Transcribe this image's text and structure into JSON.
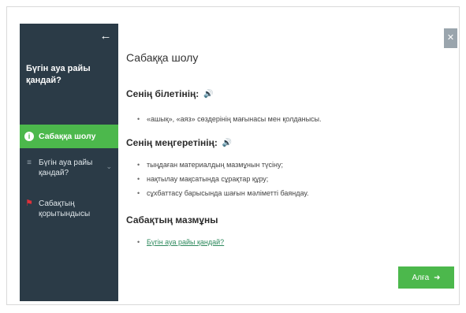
{
  "sidebar": {
    "back_icon": "←",
    "lesson_title": "Бүгін ауа райы қандай?",
    "items": [
      {
        "label": "Сабаққа шолу",
        "icon": "info-icon",
        "active": true
      },
      {
        "label": "Бүгін ауа райы қандай?",
        "icon": "list-icon",
        "active": false
      },
      {
        "label": "Сабақтың қорытындысы",
        "icon": "flag-icon",
        "active": false
      }
    ]
  },
  "close_icon": "✕",
  "main": {
    "title": "Сабаққа шолу",
    "sections": [
      {
        "heading": "Сенің білетінің:",
        "bullets": [
          "«ашық», «аяз» сөздерінің мағынасы мен қолданысы."
        ]
      },
      {
        "heading": "Сенің меңгеретінің:",
        "bullets": [
          "тыңдаған материалдың мазмұнын түсіну;",
          "нақтылау мақсатында сұрақтар құру;",
          "сұхбаттасу барысында шағын мәліметті баяндау."
        ]
      },
      {
        "heading": "Сабақтың мазмұны",
        "links": [
          "Бүгін ауа райы қандай?"
        ]
      }
    ]
  },
  "next_button": {
    "label": "Алға",
    "icon": "➜"
  },
  "colors": {
    "sidebar_bg": "#2b3b47",
    "accent": "#4cb84c",
    "link": "#2f8a5e"
  }
}
